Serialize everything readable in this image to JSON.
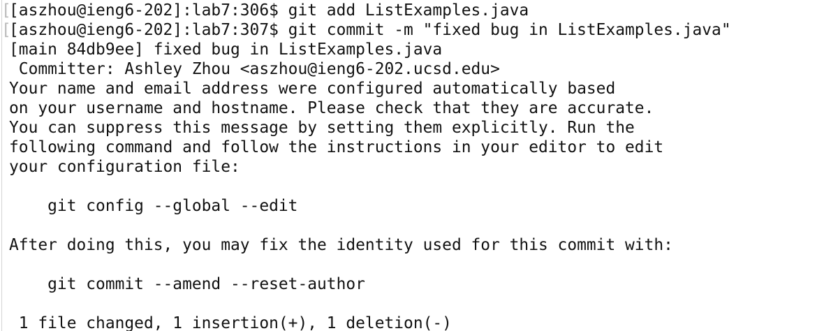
{
  "terminal": {
    "lines": [
      {
        "mark": "[",
        "text": "[aszhou@ieng6-202]:lab7:306$ git add ListExamples.java"
      },
      {
        "mark": "[",
        "text": "[aszhou@ieng6-202]:lab7:307$ git commit -m \"fixed bug in ListExamples.java\""
      },
      {
        "mark": "",
        "text": "[main 84db9ee] fixed bug in ListExamples.java"
      },
      {
        "mark": "",
        "text": " Committer: Ashley Zhou <aszhou@ieng6-202.ucsd.edu>"
      },
      {
        "mark": "",
        "text": "Your name and email address were configured automatically based"
      },
      {
        "mark": "",
        "text": "on your username and hostname. Please check that they are accurate."
      },
      {
        "mark": "",
        "text": "You can suppress this message by setting them explicitly. Run the"
      },
      {
        "mark": "",
        "text": "following command and follow the instructions in your editor to edit"
      },
      {
        "mark": "",
        "text": "your configuration file:"
      },
      {
        "mark": "",
        "text": ""
      },
      {
        "mark": "",
        "text": "    git config --global --edit"
      },
      {
        "mark": "",
        "text": ""
      },
      {
        "mark": "",
        "text": "After doing this, you may fix the identity used for this commit with:"
      },
      {
        "mark": "",
        "text": ""
      },
      {
        "mark": "",
        "text": "    git commit --amend --reset-author"
      },
      {
        "mark": "",
        "text": ""
      },
      {
        "mark": "",
        "text": " 1 file changed, 1 insertion(+), 1 deletion(-)"
      }
    ]
  }
}
